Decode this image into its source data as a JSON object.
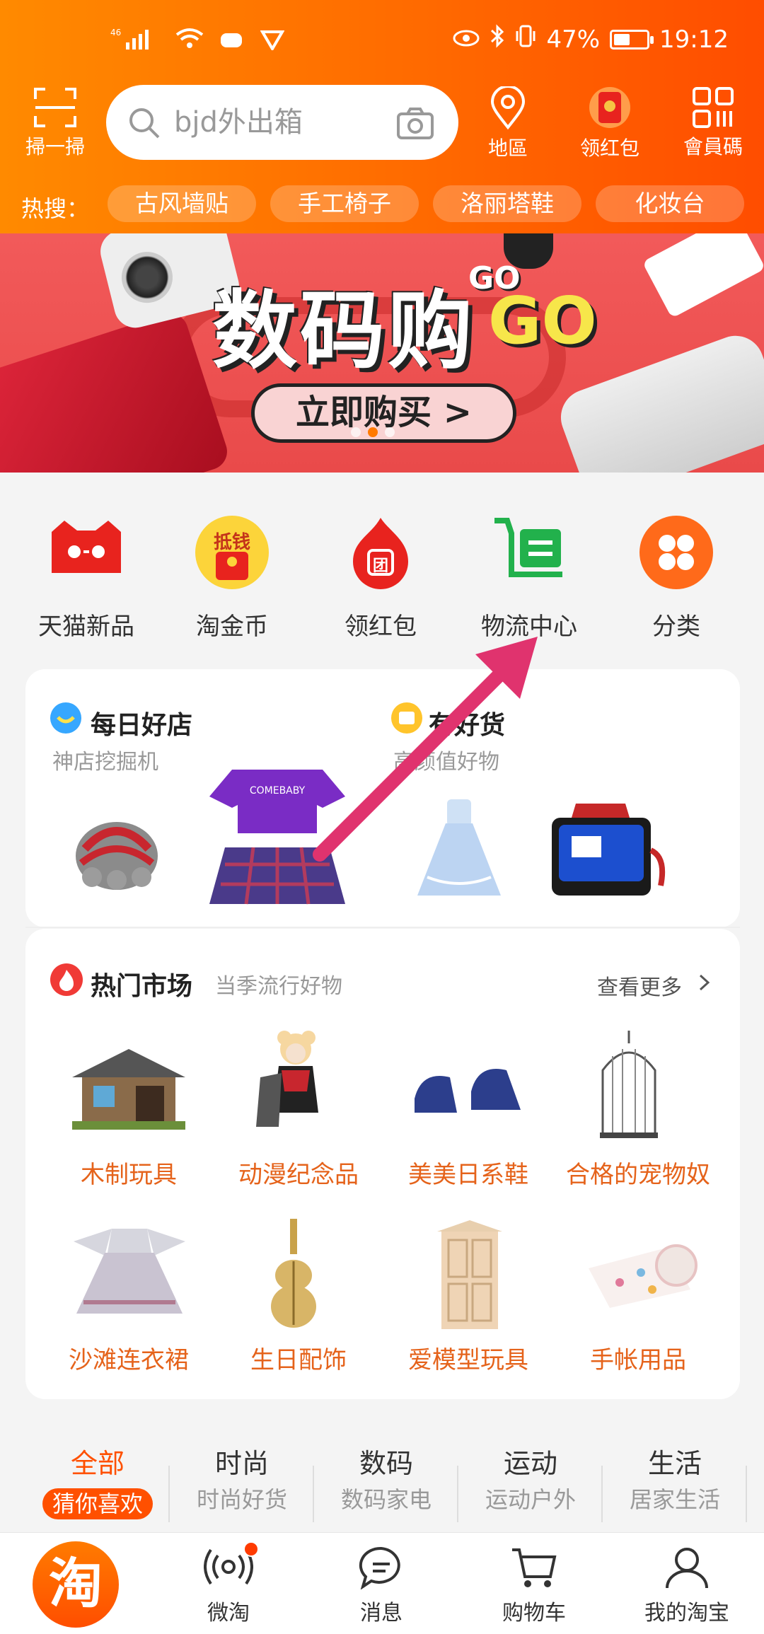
{
  "status_bar": {
    "network": "46",
    "battery_percent": "47%",
    "time": "19:12"
  },
  "topbar": {
    "scan_label": "掃一掃",
    "search_placeholder": "bjd外出箱",
    "location_label": "地區",
    "redpacket_label": "领红包",
    "member_label": "會員碼"
  },
  "hot_search": {
    "label": "热搜：",
    "chips": [
      "古风墙贴",
      "手工椅子",
      "洛丽塔鞋",
      "化妆台"
    ]
  },
  "banner": {
    "title": "数码购",
    "go_small": "GO",
    "go_big": "GO",
    "button": "立即购买 >",
    "slide_count": 3,
    "active_slide": 2
  },
  "categories": [
    {
      "label": "天猫新品",
      "icon": "tmall-cat-icon"
    },
    {
      "label": "淘金币",
      "icon": "gold-coin-icon",
      "badge": "抵钱"
    },
    {
      "label": "领红包",
      "icon": "red-packet-icon",
      "badge": "团"
    },
    {
      "label": "物流中心",
      "icon": "logistics-icon"
    },
    {
      "label": "分类",
      "icon": "category-grid-icon"
    }
  ],
  "daily": {
    "shop_title": "每日好店",
    "shop_sub": "神店挖掘机",
    "goods_title": "有好货",
    "goods_sub": "高颜值好物",
    "shirt_text": "COMEBABY"
  },
  "hot_market": {
    "title": "热门市场",
    "subtitle": "当季流行好物",
    "more": "查看更多",
    "items": [
      "木制玩具",
      "动漫纪念品",
      "美美日系鞋",
      "合格的宠物奴",
      "沙滩连衣裙",
      "生日配饰",
      "爱模型玩具",
      "手帐用品"
    ]
  },
  "feed_tabs": [
    {
      "title": "全部",
      "sub": "猜你喜欢",
      "active": true
    },
    {
      "title": "时尚",
      "sub": "时尚好货"
    },
    {
      "title": "数码",
      "sub": "数码家电"
    },
    {
      "title": "运动",
      "sub": "运动户外"
    },
    {
      "title": "生活",
      "sub": "居家生活"
    }
  ],
  "bottom_nav": {
    "home_logo": "淘",
    "items": [
      "微淘",
      "消息",
      "购物车",
      "我的淘宝"
    ]
  },
  "colors": {
    "brand": "#ff5000",
    "header_start": "#ff8a00",
    "market_text": "#e5631b",
    "arrow": "#e0336e"
  }
}
